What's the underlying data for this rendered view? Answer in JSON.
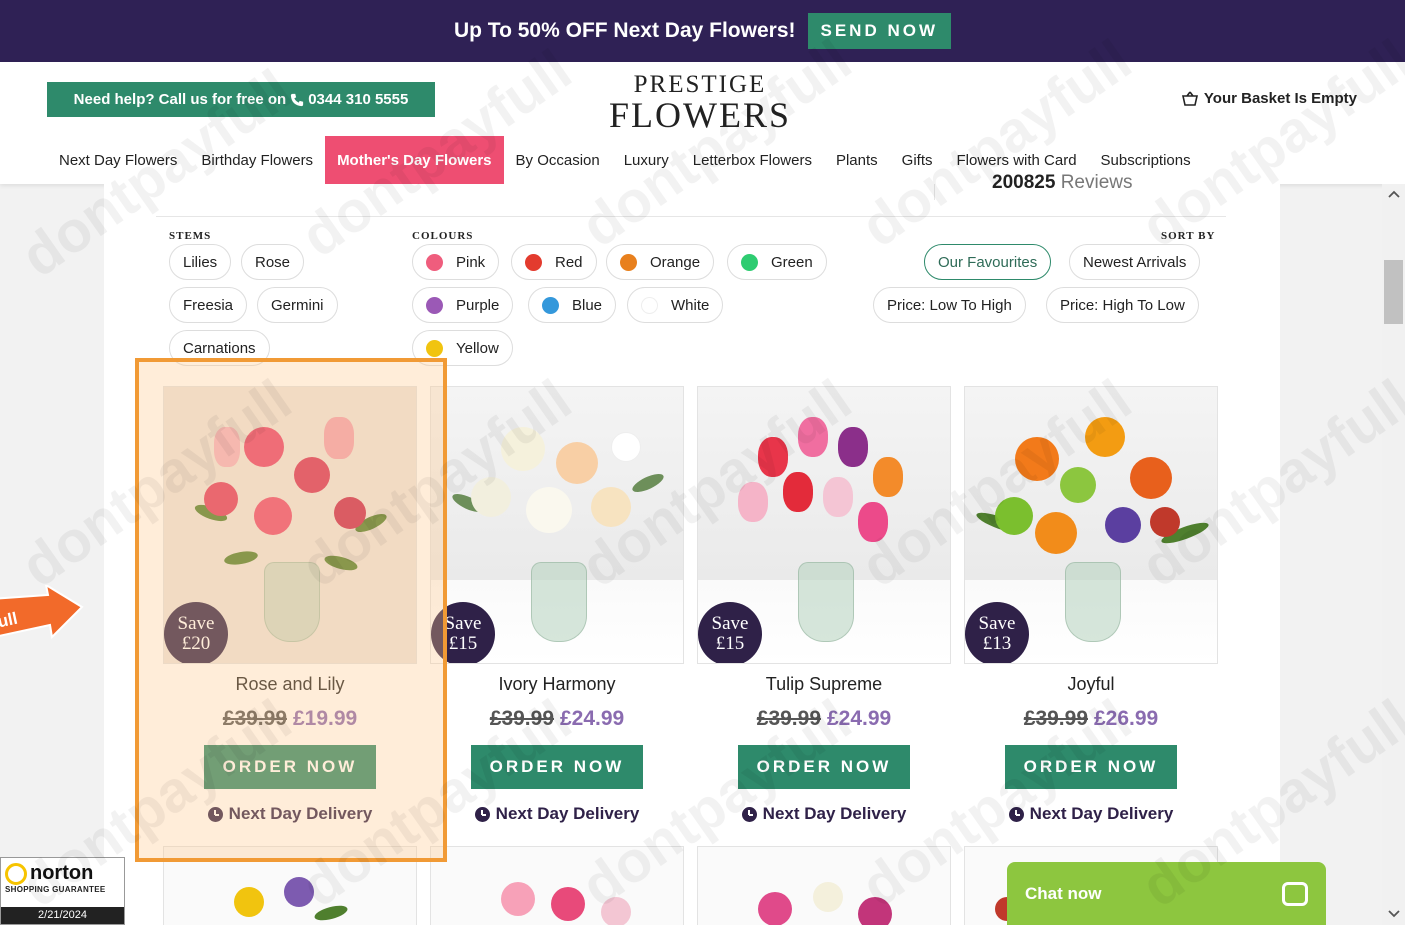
{
  "promo": {
    "text": "Up To 50% OFF Next Day Flowers!",
    "button": "SEND NOW"
  },
  "header": {
    "help_text": "Need help? Call us for free on",
    "phone": "0344 310 5555",
    "logo_line1": "PRESTIGE",
    "logo_line2": "FLOWERS",
    "basket": "Your Basket Is Empty"
  },
  "nav": [
    "Next Day Flowers",
    "Birthday Flowers",
    "Mother's Day Flowers",
    "By Occasion",
    "Luxury",
    "Letterbox Flowers",
    "Plants",
    "Gifts",
    "Flowers with Card",
    "Subscriptions"
  ],
  "reviews": {
    "count": "200825",
    "label": "Reviews"
  },
  "filters": {
    "stems_label": "STEMS",
    "stems": [
      "Lilies",
      "Rose",
      "Freesia",
      "Germini",
      "Carnations"
    ],
    "colours_label": "COLOURS",
    "colours": [
      {
        "name": "Pink",
        "color": "#ef5d7d"
      },
      {
        "name": "Red",
        "color": "#e33b2e"
      },
      {
        "name": "Orange",
        "color": "#e8801d"
      },
      {
        "name": "Green",
        "color": "#2ecc71"
      },
      {
        "name": "Purple",
        "color": "#9b59b6"
      },
      {
        "name": "Blue",
        "color": "#3498db"
      },
      {
        "name": "White",
        "color": "#ffffff"
      },
      {
        "name": "Yellow",
        "color": "#f1c40f"
      }
    ],
    "sort_label": "SORT BY",
    "sort": [
      "Our Favourites",
      "Newest Arrivals",
      "Price: Low To High",
      "Price: High To Low"
    ]
  },
  "products": [
    {
      "name": "Rose and Lily",
      "save_label": "Save",
      "save_amount": "£20",
      "old_price": "£39.99",
      "new_price": "£19.99",
      "order": "ORDER NOW",
      "delivery": "Next Day Delivery"
    },
    {
      "name": "Ivory Harmony",
      "save_label": "Save",
      "save_amount": "£15",
      "old_price": "£39.99",
      "new_price": "£24.99",
      "order": "ORDER NOW",
      "delivery": "Next Day Delivery"
    },
    {
      "name": "Tulip Supreme",
      "save_label": "Save",
      "save_amount": "£15",
      "old_price": "£39.99",
      "new_price": "£24.99",
      "order": "ORDER NOW",
      "delivery": "Next Day Delivery"
    },
    {
      "name": "Joyful",
      "save_label": "Save",
      "save_amount": "£13",
      "old_price": "£39.99",
      "new_price": "£26.99",
      "order": "ORDER NOW",
      "delivery": "Next Day Delivery"
    }
  ],
  "norton": {
    "name": "norton",
    "sub": "SHOPPING GUARANTEE",
    "date": "2/21/2024"
  },
  "chat": {
    "label": "Chat now"
  },
  "side_tab": {
    "text": "full"
  },
  "watermark": "dontpayfull"
}
